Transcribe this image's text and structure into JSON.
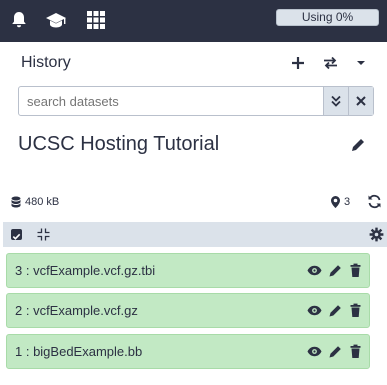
{
  "masthead": {
    "icons": [
      "bell-icon",
      "graduation-cap-icon",
      "grid-icon"
    ],
    "usage_label": "Using 0%"
  },
  "history": {
    "title": "History",
    "header_icons": [
      "plus-icon",
      "switch-icon",
      "caret-down-icon"
    ],
    "search_placeholder": "search datasets",
    "name": "UCSC Hosting Tutorial",
    "size": "480 kB",
    "item_count": "3"
  },
  "datasets": [
    {
      "label": "3 : vcfExample.vcf.gz.tbi",
      "state_color": "#c2e9c4"
    },
    {
      "label": "2 : vcfExample.vcf.gz",
      "state_color": "#c2e9c4"
    },
    {
      "label": "1 : bigBedExample.bb",
      "state_color": "#c2e9c4"
    }
  ],
  "colors": {
    "masthead": "#2c3143",
    "toolbar": "#dbe2ea",
    "dataset_ok": "#c2e9c4",
    "text": "#2c3143"
  }
}
